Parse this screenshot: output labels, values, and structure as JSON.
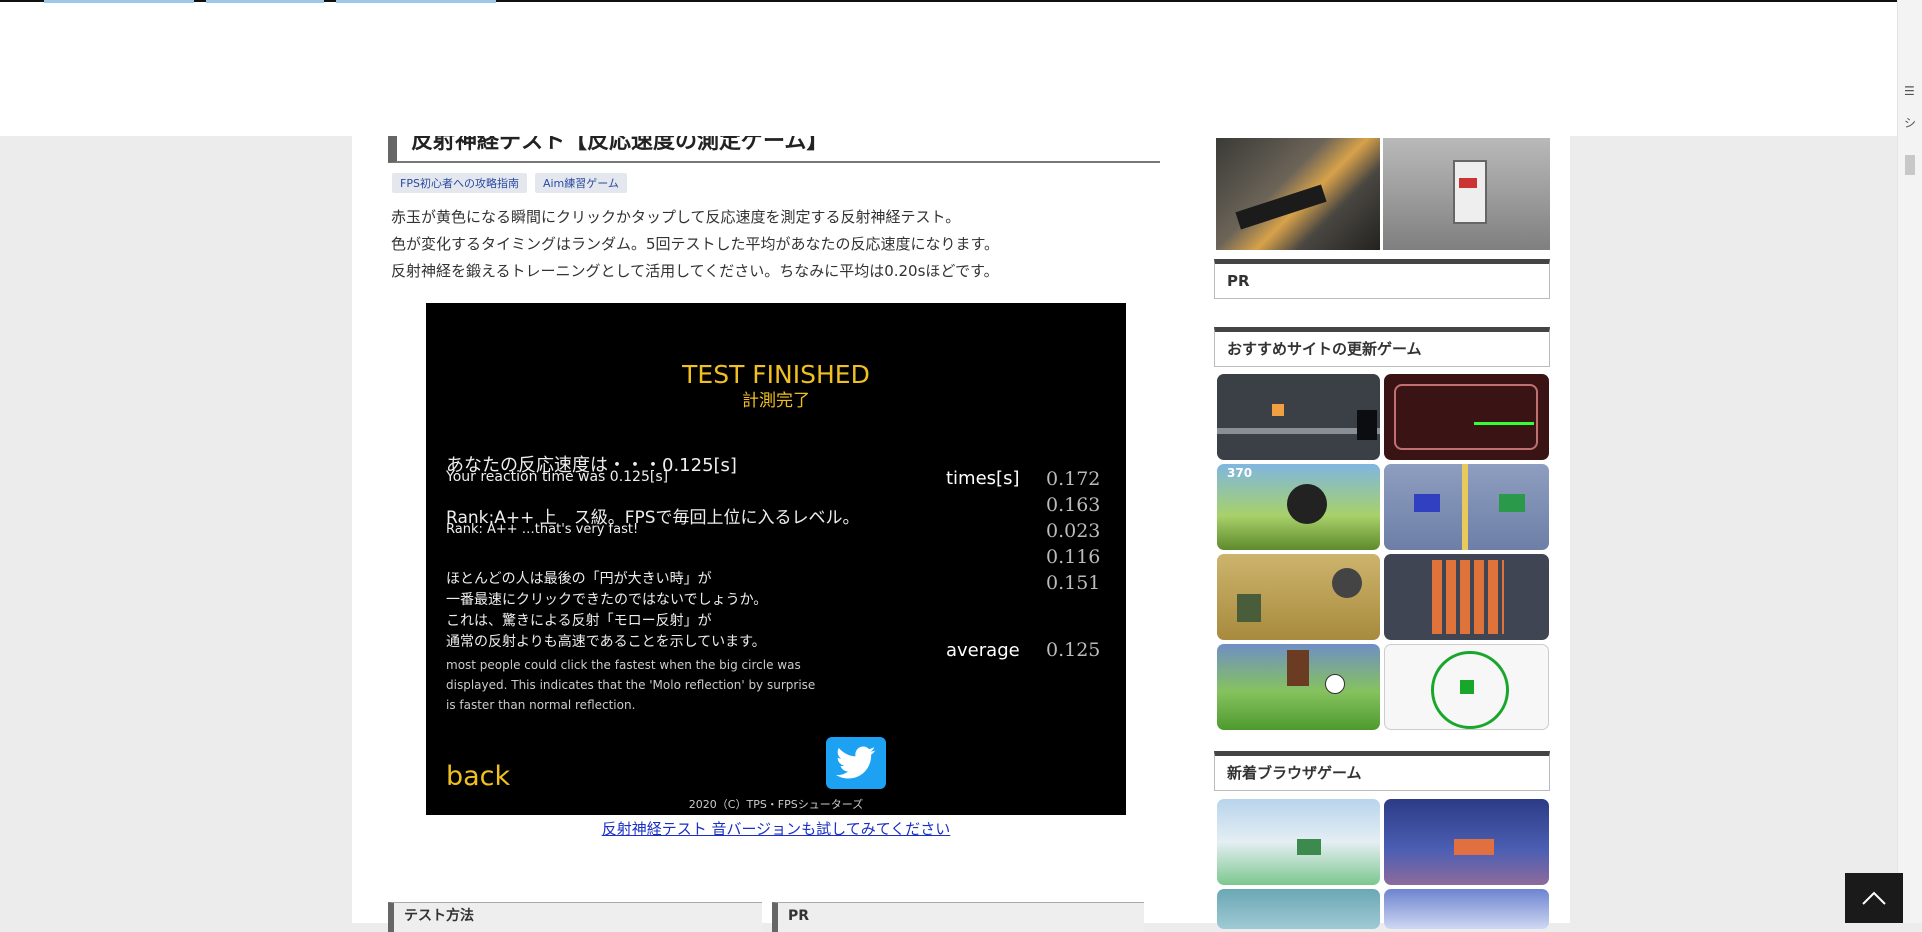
{
  "post": {
    "title": "反射神経テスト【反応速度の測定ゲーム】",
    "tags": [
      "FPS初心者への攻略指南",
      "Aim練習ゲーム"
    ],
    "intro": [
      "赤玉が黄色になる瞬間にクリックかタップして反応速度を測定する反射神経テスト。",
      "色が変化するタイミングはランダム。5回テストした平均があなたの反応速度になります。",
      "反射神経を鍛えるトレーニングとして活用してください。ちなみに平均は0.20sほどです。"
    ]
  },
  "game": {
    "title": "TEST FINISHED",
    "subtitle": "計測完了",
    "reaction_jp": "あなたの反応速度は・・・0.125[s]",
    "reaction_en": "Your reaction time was 0.125[s]",
    "rank_jp": "Rank:A++ 上　ス級。FPSで毎回上位に入るレベル。",
    "rank_en": "Rank: A++ …that's very fast!",
    "note_jp": [
      "ほとんどの人は最後の「円が大きい時」が",
      "一番最速にクリックできたのではないでしょうか。",
      "これは、驚きによる反射「モロー反射」が",
      "通常の反射よりも高速であることを示しています。"
    ],
    "note_en": [
      "most people could click the fastest when the big circle was",
      "displayed.  This indicates that the 'Molo reflection' by surprise",
      "is faster than normal reflection."
    ],
    "times_label": "times[s]",
    "times": [
      "0.172",
      "0.163",
      "0.023",
      "0.116",
      "0.151"
    ],
    "average_label": "average",
    "average": "0.125",
    "back": "back",
    "copyright": "2020（C）TPS・FPSシューターズ"
  },
  "sound_link": "反射神経テスト 音バージョンも試してみてください",
  "bottom_boxes": [
    "テスト方法",
    "PR"
  ],
  "sidebar": {
    "pr_label": "PR",
    "recommend_title": "おすすめサイトの更新ゲーム",
    "new_title": "新着ブラウザゲーム",
    "badge_370": "370"
  },
  "scrollbar": {
    "glyph1": "☰",
    "glyph2": "シ"
  }
}
